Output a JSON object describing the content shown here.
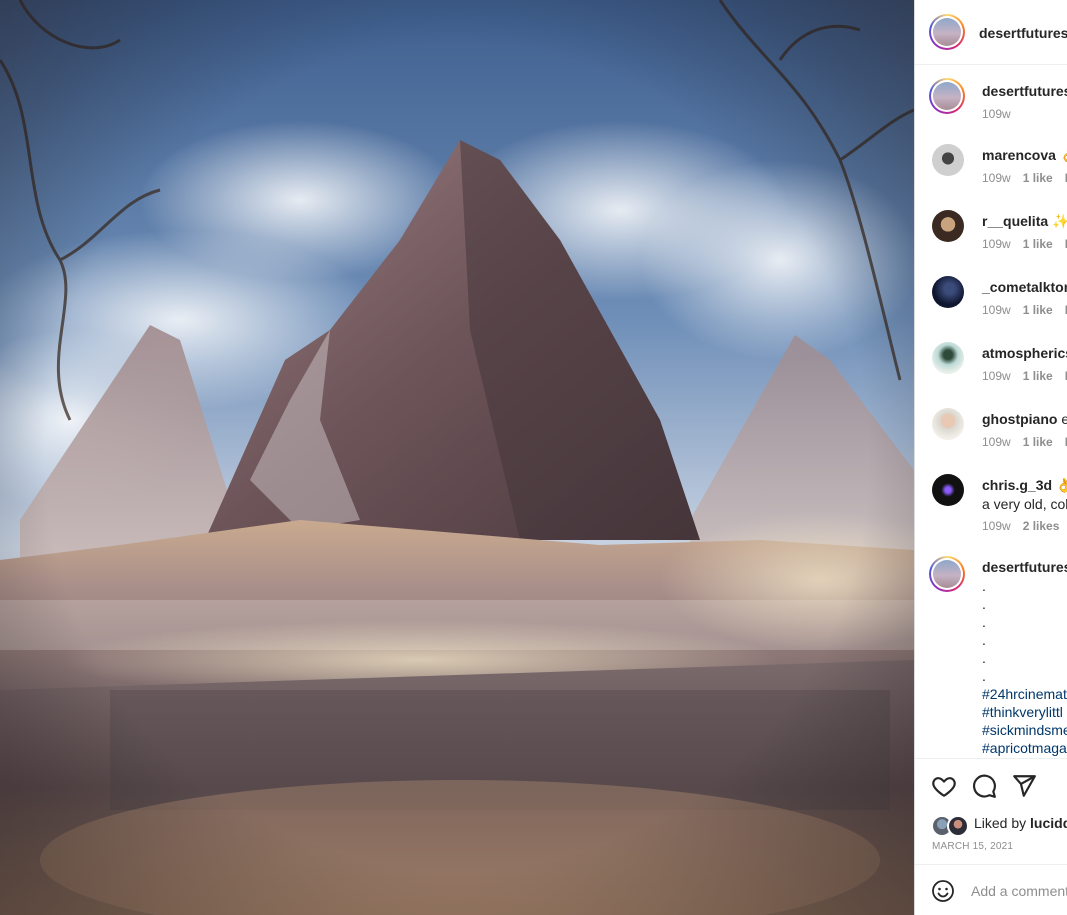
{
  "post": {
    "author": "desertfutures",
    "image_alt": "Surreal desert landscape with three rocky peaks above a misty plateau"
  },
  "caption": {
    "username": "desertfutures",
    "time": "109w",
    "dots": [
      ".",
      ".",
      ".",
      ".",
      ".",
      "."
    ],
    "hashtags": [
      "#24hrcinemat",
      "#thinkverylittl",
      "#sickmindsme",
      "#apricotmaga"
    ]
  },
  "comments": [
    {
      "username": "marencova",
      "text": "👌",
      "time": "109w",
      "likes": "1 like",
      "reply": "R"
    },
    {
      "username": "r__quelita",
      "text": "✨",
      "time": "109w",
      "likes": "1 like",
      "reply": "R"
    },
    {
      "username": "_cometalktom",
      "text": "",
      "time": "109w",
      "likes": "1 like",
      "reply": "R"
    },
    {
      "username": "atmospherics",
      "text": "",
      "time": "109w",
      "likes": "1 like",
      "reply": "R"
    },
    {
      "username": "ghostpiano",
      "text": "e",
      "time": "109w",
      "likes": "1 like",
      "reply": "R"
    },
    {
      "username": "chris.g_3d",
      "text": "👌",
      "body": "a very old, col",
      "time": "109w",
      "likes": "2 likes",
      "reply": ""
    }
  ],
  "actions": {
    "liked_by_prefix": "Liked by",
    "liked_by_user": "lucidd",
    "date": "MARCH 15, 2021"
  },
  "add_comment": {
    "placeholder": "Add a comment"
  },
  "colors": {
    "link": "#00376b",
    "muted": "#8e8e8e",
    "text": "#262626"
  },
  "icons": [
    "heart-icon",
    "comment-icon",
    "share-icon",
    "emoji-icon"
  ]
}
